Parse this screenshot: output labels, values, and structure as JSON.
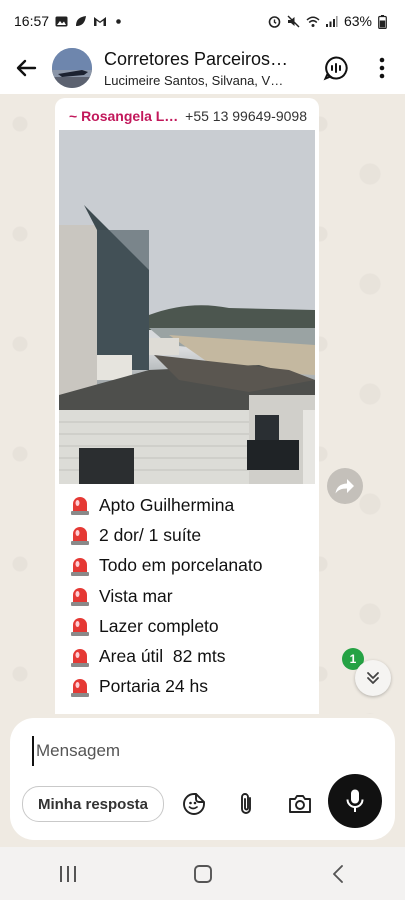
{
  "status_bar": {
    "time": "16:57",
    "battery": "63%",
    "left_icons": [
      "gallery-icon",
      "leaf-icon",
      "gmail-icon",
      "dot-icon"
    ],
    "right_icons": [
      "alarm-icon",
      "mute-icon",
      "wifi-icon",
      "signal-icon",
      "battery-icon"
    ]
  },
  "header": {
    "title": "Corretores Parceiros…",
    "subtitle": "Lucimeire Santos, Silvana, V…",
    "icons": [
      "back-arrow-icon",
      "group-avatar",
      "voice-chat-icon",
      "more-vert-icon"
    ]
  },
  "message": {
    "sender_name": "~ Rosangela L…",
    "sender_phone": "+55 13 99649-9098",
    "image_alt": "building-view-photo",
    "list_icon": "red-siren-icon",
    "lines": [
      "Apto Guilhermina",
      "2 dor/ 1 suíte",
      "Todo em porcelanato",
      "Vista mar",
      "Lazer completo",
      "Area útil  82 mts",
      "Portaria 24 hs"
    ]
  },
  "floating": {
    "unread_count": "1",
    "icons": [
      "forward-icon",
      "double-chevron-down-icon"
    ]
  },
  "composer": {
    "placeholder": "Mensagem",
    "value": "",
    "quick_reply": "Minha resposta",
    "icons": [
      "sticker-icon",
      "attach-icon",
      "camera-icon",
      "mic-icon"
    ]
  },
  "nav_bar": {
    "icons": [
      "recents-icon",
      "home-icon",
      "back-icon"
    ]
  },
  "colors": {
    "sender_name": "#c2185b",
    "chat_background": "#efeae2",
    "unread_badge": "#25a244",
    "mic_button": "#111111"
  }
}
